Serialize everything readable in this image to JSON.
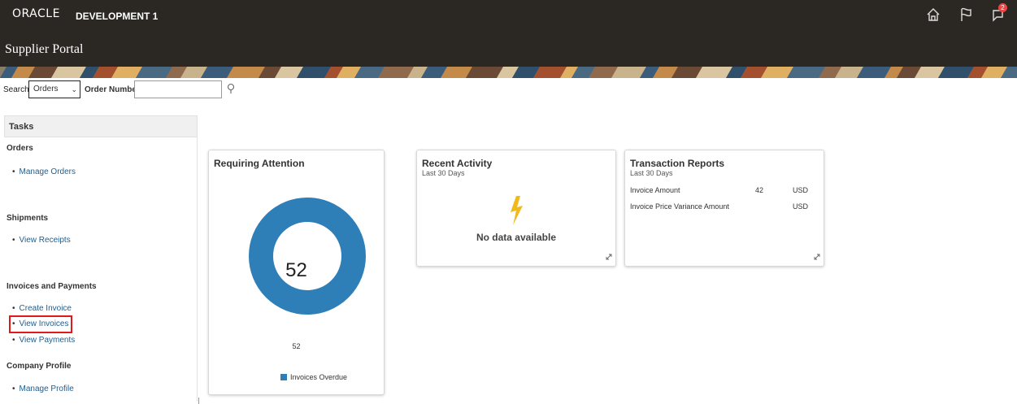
{
  "header": {
    "brand": "ORACLE",
    "environment": "DEVELOPMENT 1",
    "portal_title": "Supplier Portal",
    "notification_count": "2",
    "icons": [
      "home-icon",
      "flag-icon",
      "notifications-icon"
    ]
  },
  "search": {
    "label": "Search",
    "category": "Orders",
    "field_label": "Order Number",
    "value": ""
  },
  "tasks": {
    "title": "Tasks",
    "groups": [
      {
        "title": "Orders",
        "items": [
          "Manage Orders"
        ]
      },
      {
        "title": "Shipments",
        "items": [
          "View Receipts"
        ]
      },
      {
        "title": "Invoices and Payments",
        "items": [
          "Create Invoice",
          "View Invoices",
          "View Payments"
        ]
      },
      {
        "title": "Company Profile",
        "items": [
          "Manage Profile"
        ]
      }
    ],
    "highlighted_item": "View Invoices"
  },
  "cards": {
    "attention": {
      "title": "Requiring Attention",
      "total": "52",
      "value_label": "52",
      "legend": "Invoices Overdue",
      "color": "#2e7fb8"
    },
    "activity": {
      "title": "Recent Activity",
      "subtitle": "Last 30 Days",
      "empty": "No data available",
      "icon": "lightning-icon"
    },
    "reports": {
      "title": "Transaction Reports",
      "subtitle": "Last 30 Days",
      "rows": [
        {
          "label": "Invoice Amount",
          "amount": "42",
          "currency": "USD"
        },
        {
          "label": "Invoice Price Variance Amount",
          "amount": "",
          "currency": "USD"
        }
      ]
    }
  }
}
